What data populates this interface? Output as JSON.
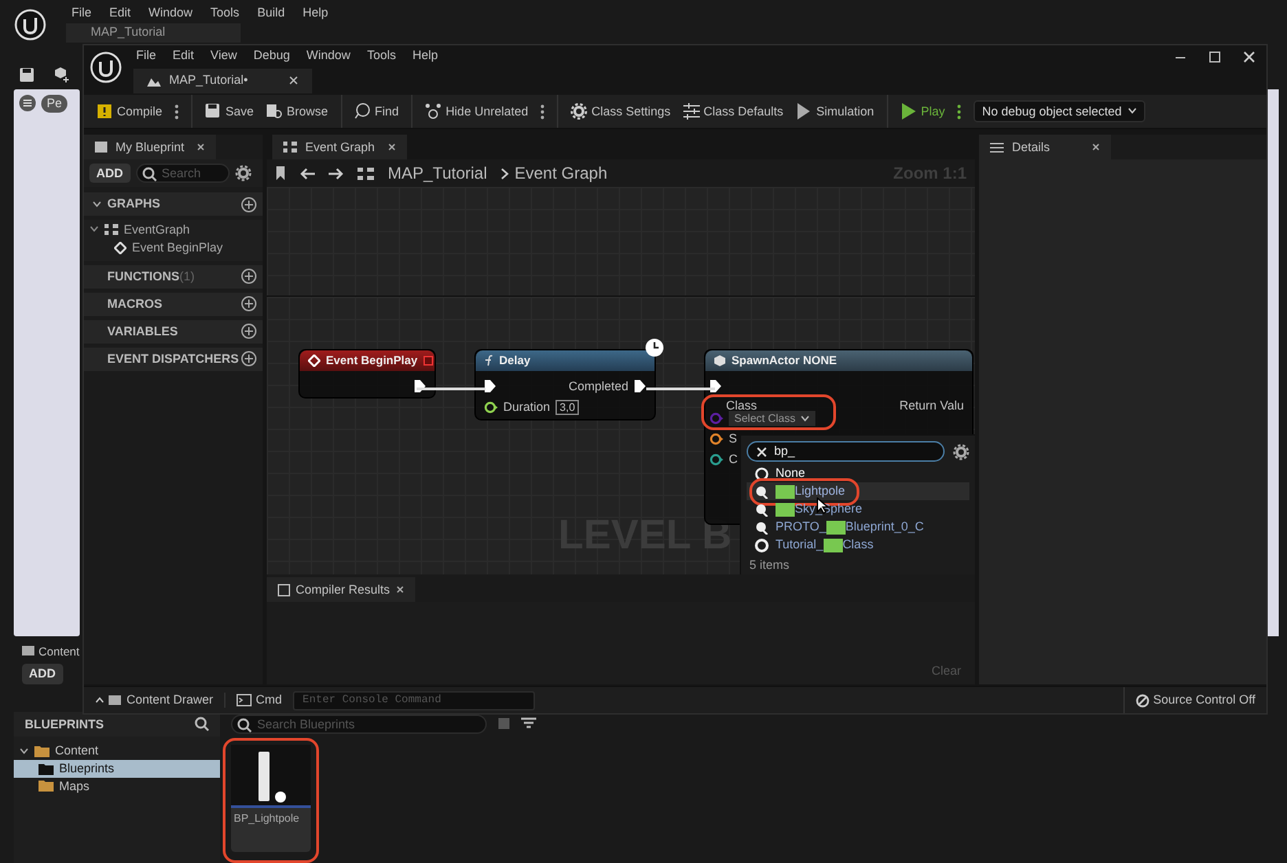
{
  "back_window": {
    "menu": [
      "File",
      "Edit",
      "Window",
      "Tools",
      "Build",
      "Help"
    ],
    "tab": {
      "label": "MAP_Tutorial"
    },
    "viewport_pill": "Pe",
    "content_tab": "Content",
    "add_button": "ADD",
    "sources": {
      "title": "BLUEPRINTS",
      "tree": [
        {
          "label": "Content",
          "expanded": true,
          "selected": false,
          "children": [
            {
              "label": "Blueprints",
              "selected": true
            },
            {
              "label": "Maps",
              "selected": false
            }
          ]
        }
      ]
    },
    "asset_search": {
      "placeholder": "Search Blueprints"
    },
    "assets": [
      {
        "label": "BP_Lightpole",
        "circled": true
      }
    ]
  },
  "window": {
    "menu": [
      "File",
      "Edit",
      "View",
      "Debug",
      "Window",
      "Tools",
      "Help"
    ],
    "tab": {
      "label": "MAP_Tutorial•"
    },
    "toolbar": [
      [
        {
          "kind": "compile",
          "label": "Compile",
          "has_menu": true
        }
      ],
      [
        {
          "kind": "save",
          "label": "Save",
          "has_menu": false
        },
        {
          "kind": "browse",
          "label": "Browse",
          "has_menu": false
        }
      ],
      [
        {
          "kind": "find",
          "label": "Find",
          "has_menu": false
        }
      ],
      [
        {
          "kind": "hide",
          "label": "Hide Unrelated",
          "has_menu": true
        }
      ],
      [
        {
          "kind": "settings",
          "label": "Class Settings",
          "has_menu": false
        },
        {
          "kind": "defaults",
          "label": "Class Defaults",
          "has_menu": false
        },
        {
          "kind": "simulation",
          "label": "Simulation",
          "has_menu": false
        }
      ],
      [
        {
          "kind": "play",
          "label": "Play",
          "has_menu": true
        }
      ]
    ],
    "debug_select": {
      "value": "No debug object selected"
    },
    "my_blueprint": {
      "tab": "My Blueprint",
      "add": "ADD",
      "search": {
        "placeholder": "Search"
      },
      "sections": [
        {
          "title": "GRAPHS",
          "expanded": true,
          "children": [
            {
              "label": "EventGraph",
              "expanded": true,
              "children": [
                {
                  "label": "Event BeginPlay"
                }
              ]
            }
          ]
        },
        {
          "title": "FUNCTIONS",
          "count": "(1)",
          "expanded": false
        },
        {
          "title": "MACROS",
          "expanded": false
        },
        {
          "title": "VARIABLES",
          "expanded": false
        },
        {
          "title": "EVENT DISPATCHERS",
          "expanded": false
        }
      ]
    },
    "graph": {
      "tab": "Event Graph",
      "breadcrumb": [
        "MAP_Tutorial",
        "Event Graph"
      ],
      "zoom": "Zoom 1:1",
      "watermark": "LEVEL B",
      "nodes": [
        {
          "kind": "event",
          "title": "Event BeginPlay"
        },
        {
          "kind": "function",
          "title": "Delay",
          "latent": true,
          "output": "Completed",
          "inputs": [
            {
              "label": "Duration",
              "value": "3,0"
            }
          ]
        },
        {
          "kind": "spawn",
          "title": "SpawnActor NONE",
          "class_label": "Class",
          "class_value": "Select Class",
          "circled": true,
          "return_label": "Return Valu",
          "pins": [
            {
              "label": "S",
              "color": "#e0832a"
            },
            {
              "label": "C",
              "color": "#2a9d8f"
            }
          ]
        }
      ],
      "class_picker": {
        "search": "bp_",
        "items": [
          {
            "kind": "none",
            "label": "None",
            "redacted": false,
            "selected": false,
            "circled": false
          },
          {
            "kind": "blueprint",
            "redacted": true,
            "after": "Lightpole",
            "selected": true,
            "circled": true
          },
          {
            "kind": "blueprint",
            "redacted": true,
            "after": "Sky_Sphere",
            "selected": false,
            "circled": false
          },
          {
            "kind": "blueprint",
            "label": "PROTO_",
            "redacted": true,
            "after": "Blueprint_0_C",
            "selected": false,
            "circled": false
          },
          {
            "kind": "class",
            "label": "Tutorial_",
            "redacted": true,
            "after": "Class",
            "selected": false,
            "circled": false
          }
        ],
        "count": "5 items"
      }
    },
    "compiler": {
      "tab": "Compiler Results",
      "clear": "Clear"
    },
    "details": {
      "tab": "Details"
    },
    "status_bar": {
      "drawer": "Content Drawer",
      "cmd": "Cmd",
      "console": {
        "placeholder": "Enter Console Command"
      },
      "source_control": "Source Control Off"
    }
  }
}
